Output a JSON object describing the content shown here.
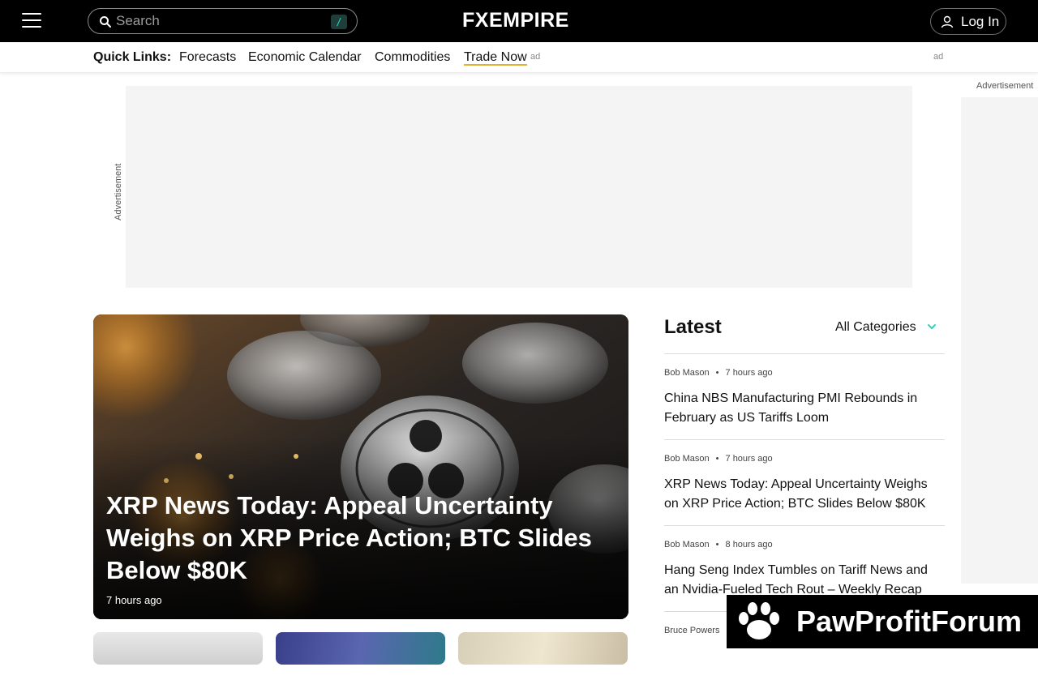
{
  "header": {
    "search_placeholder": "Search",
    "search_shortcut": "/",
    "logo": "FXEMPIRE",
    "login_label": "Log In"
  },
  "quick_links": {
    "title": "Quick Links:",
    "items": [
      "Forecasts",
      "Economic Calendar",
      "Commodities",
      "Trade Now"
    ],
    "ad_tag_1": "ad",
    "ad_tag_2": "ad"
  },
  "ads": {
    "top_label": "Advertisement",
    "side_label": "Advertisement"
  },
  "hero": {
    "title": "XRP News Today: Appeal Uncertainty Weighs on XRP Price Action; BTC Slides Below $80K",
    "time": "7 hours ago"
  },
  "latest": {
    "heading": "Latest",
    "category_filter": "All Categories",
    "items": [
      {
        "author": "Bob Mason",
        "dot": "•",
        "time": "7 hours ago",
        "headline": "China NBS Manufacturing PMI Rebounds in February as US Tariffs Loom"
      },
      {
        "author": "Bob Mason",
        "dot": "•",
        "time": "7 hours ago",
        "headline": "XRP News Today: Appeal Uncertainty Weighs on XRP Price Action; BTC Slides Below $80K"
      },
      {
        "author": "Bob Mason",
        "dot": "•",
        "time": "8 hours ago",
        "headline": "Hang Seng Index Tumbles on Tariff News and an Nvidia-Fueled Tech Rout – Weekly Recap"
      },
      {
        "author": "Bruce Powers",
        "dot": "",
        "time": "",
        "headline": ""
      }
    ]
  },
  "overlay": {
    "brand": "PawProfitForum"
  },
  "colors": {
    "accent": "#2fd3b8",
    "trade_underline": "#e3b02d",
    "topbar": "#000000"
  }
}
